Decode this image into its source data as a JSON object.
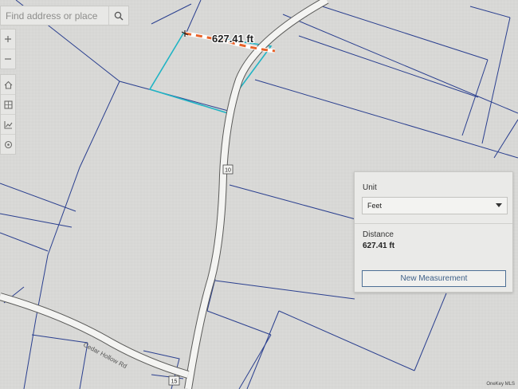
{
  "search": {
    "placeholder": "Find address or place",
    "button_icon": "search-icon"
  },
  "toolbar": {
    "zoom_in_icon": "plus-icon",
    "zoom_out_icon": "minus-icon",
    "home_icon": "home-icon",
    "basemap_icon": "basemap-icon",
    "measure_icon": "measure-icon",
    "locate_icon": "locate-icon"
  },
  "map": {
    "measurement_label": "627.41 ft",
    "road_shields": [
      "10",
      "15"
    ],
    "street_label": "Cedar Hollow Rd"
  },
  "measure_panel": {
    "unit_label": "Unit",
    "unit_value": "Feet",
    "distance_label": "Distance",
    "distance_value": "627.41 ft",
    "new_button": "New Measurement"
  },
  "credit": "OneKey MLS",
  "colors": {
    "parcel_line": "#2a3f8f",
    "selected_parcel": "#1fb3c4",
    "road_fill": "#f4f4f2",
    "measure_orange": "#e8632a",
    "button_accent": "#3f6189"
  }
}
